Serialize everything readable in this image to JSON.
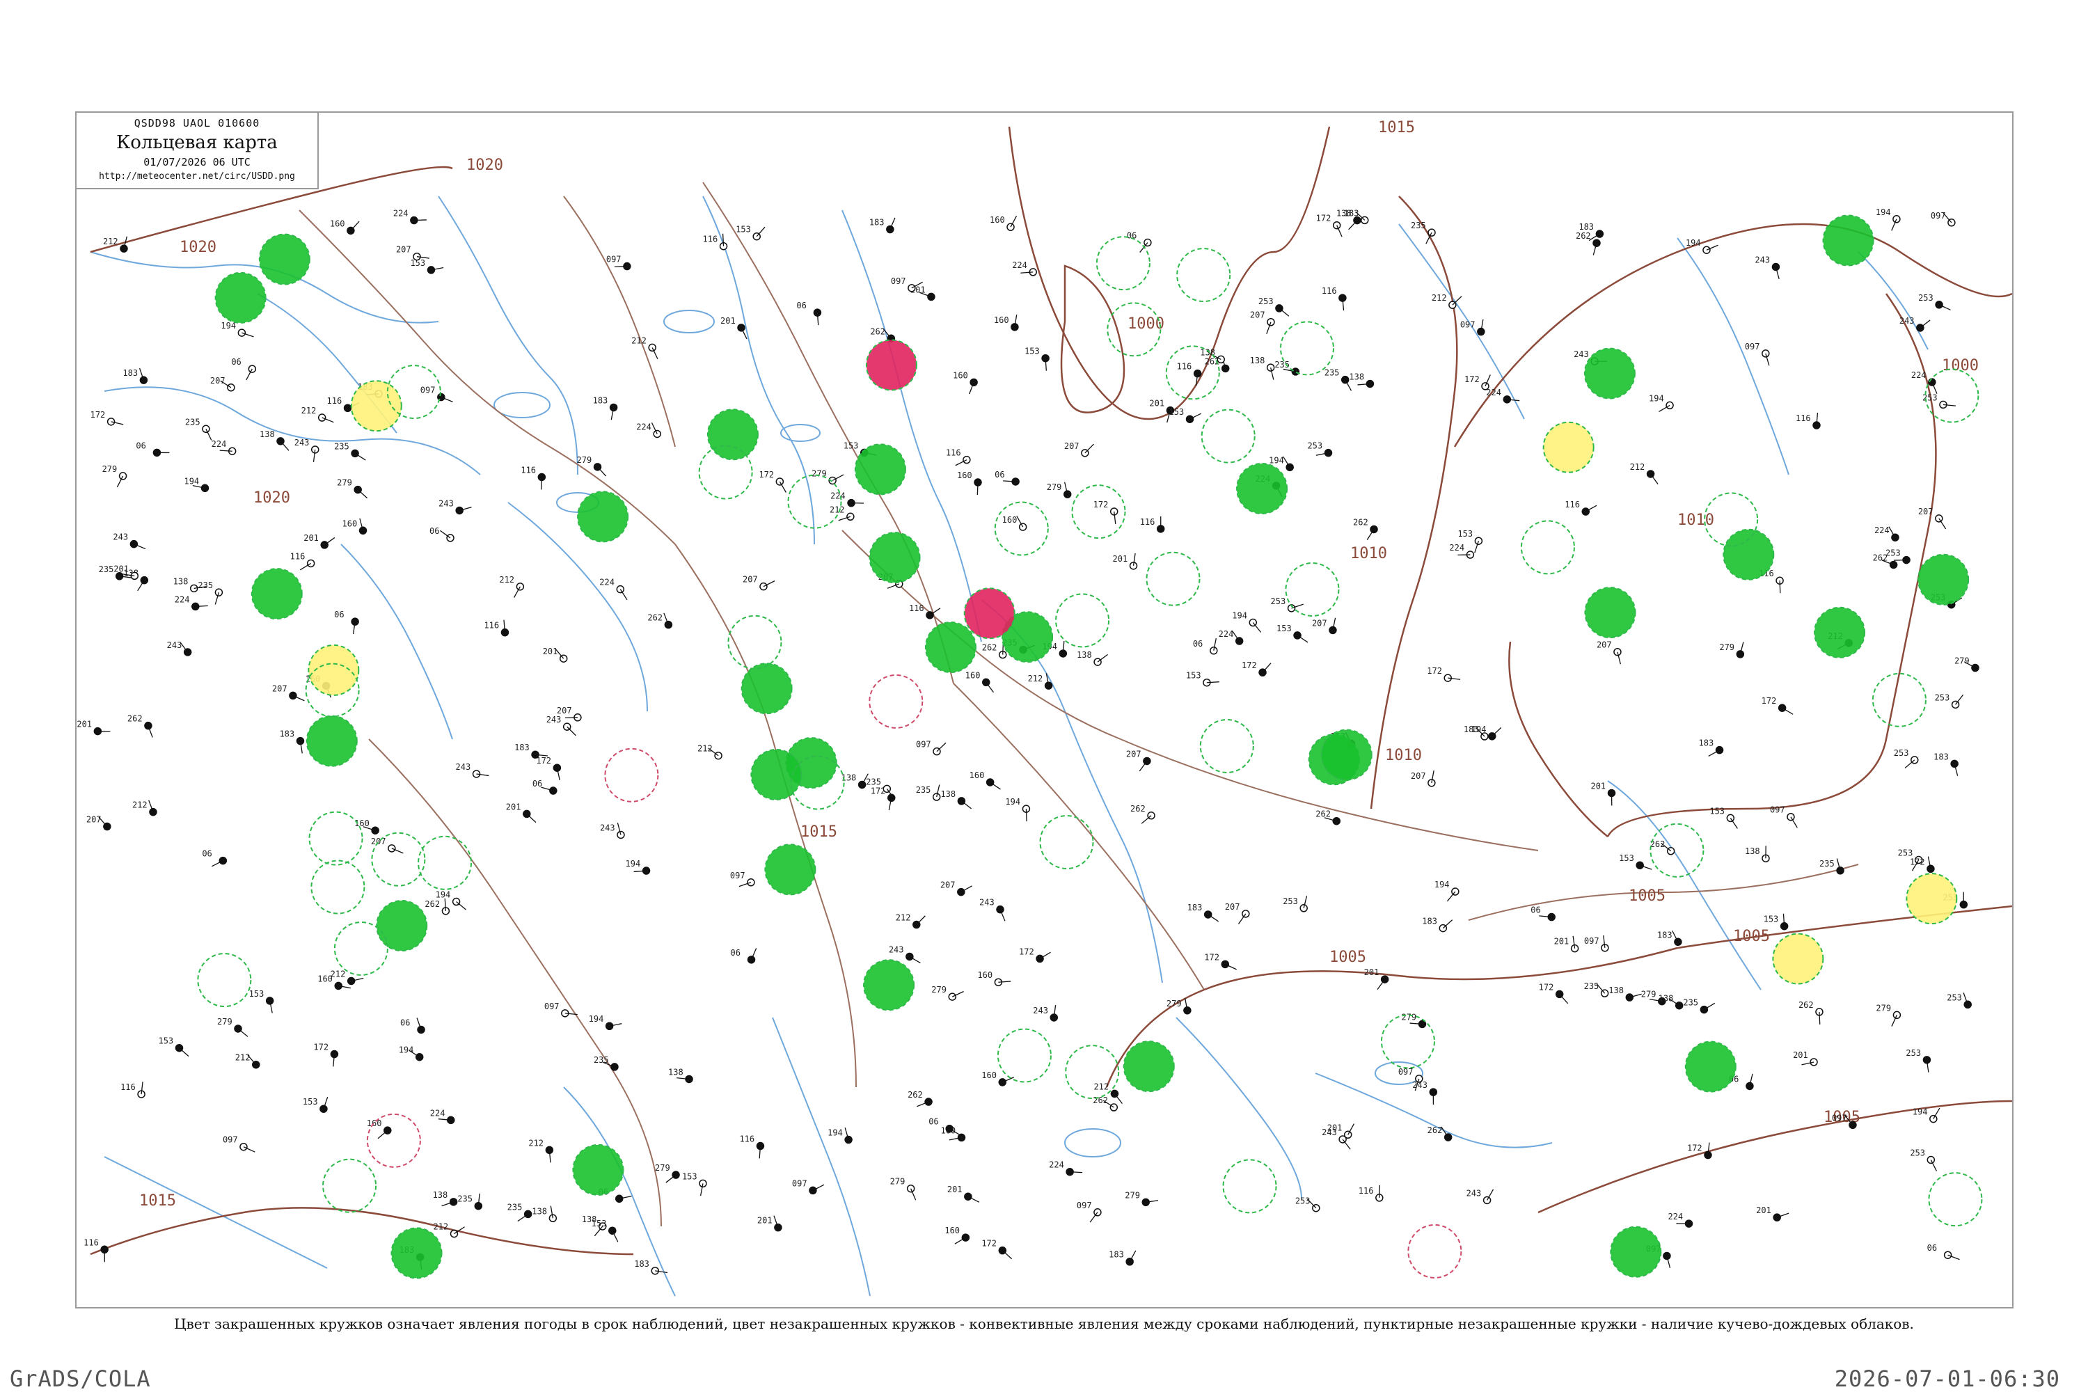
{
  "header": {
    "code": "QSDD98  UAOL  010600",
    "title": "Кольцевая карта",
    "datetime": "01/07/2026 06 UTC",
    "url": "http://meteocenter.net/circ/USDD.png"
  },
  "caption": "Цвет закрашенных кружков означает явления погоды в срок наблюдений, цвет незакрашенных кружков - конвективные явления между сроками наблюдений, пунктирные незакрашенные кружки - наличие кучево-дождевых облаков.",
  "footer": {
    "left": "GrADS/COLA",
    "right": "2026-07-01-06:30"
  },
  "isobar_labels": [
    "1020",
    "1020",
    "1020",
    "1015",
    "1015",
    "1015",
    "1010",
    "1010",
    "1010",
    "1005",
    "1005",
    "1005",
    "1005",
    "1000",
    "1000"
  ],
  "colors": {
    "isobar": "#8b4a3a",
    "river": "#6fa8dc",
    "road": "#9b7060",
    "fill_green": "#19c12e",
    "fill_yellow": "#fff27a",
    "fill_red": "#e0245e",
    "fill_lightgreen": "#6fe08f",
    "ring_green": "#2fb94a",
    "ring_red": "#d04a6a"
  },
  "filled_circles": [
    {
      "phenomenon": "rain",
      "color": "#19c12e",
      "count": 30
    },
    {
      "phenomenon": "drizzle",
      "color": "#fff27a",
      "count": 5
    },
    {
      "phenomenon": "thunderstorm",
      "color": "#e0245e",
      "count": 2
    }
  ],
  "station_samples": [
    "194",
    "097",
    "06",
    "116",
    "138",
    "153",
    "160",
    "172",
    "183",
    "201",
    "207",
    "212",
    "224",
    "235",
    "243",
    "253",
    "262",
    "279"
  ]
}
